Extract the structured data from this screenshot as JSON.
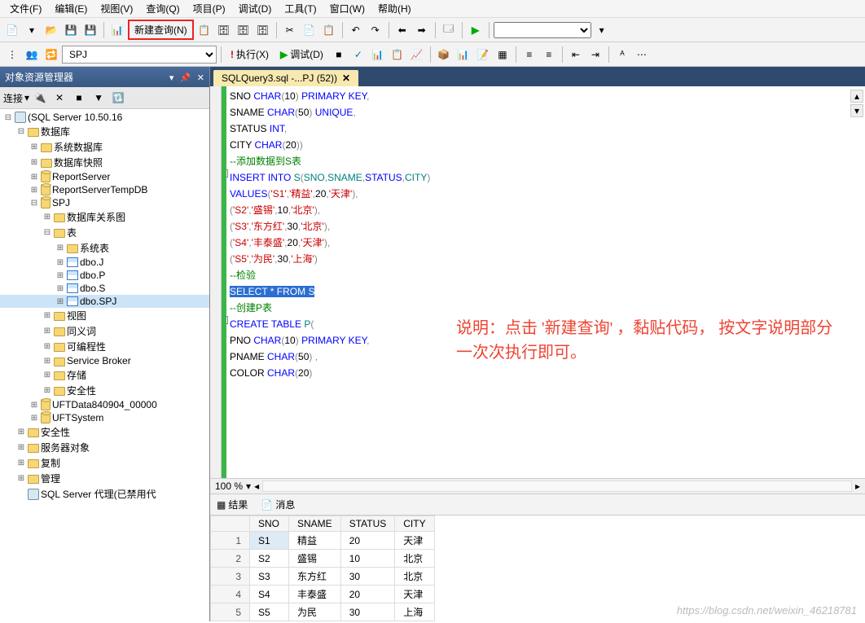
{
  "menu": [
    "文件(F)",
    "编辑(E)",
    "视图(V)",
    "查询(Q)",
    "项目(P)",
    "调试(D)",
    "工具(T)",
    "窗口(W)",
    "帮助(H)"
  ],
  "toolbar": {
    "new_query": "新建查询(N)",
    "execute": "执行(X)",
    "debug": "调试(D)",
    "db": "SPJ"
  },
  "sidebar": {
    "title": "对象资源管理器",
    "connect": "连接",
    "nodes": [
      {
        "ind": 0,
        "exp": "⊟",
        "ico": "server",
        "label": "(SQL Server 10.50.16"
      },
      {
        "ind": 1,
        "exp": "⊟",
        "ico": "folder",
        "label": "数据库"
      },
      {
        "ind": 2,
        "exp": "⊞",
        "ico": "folder",
        "label": "系统数据库"
      },
      {
        "ind": 2,
        "exp": "⊞",
        "ico": "folder",
        "label": "数据库快照"
      },
      {
        "ind": 2,
        "exp": "⊞",
        "ico": "db",
        "label": "ReportServer"
      },
      {
        "ind": 2,
        "exp": "⊞",
        "ico": "db",
        "label": "ReportServerTempDB"
      },
      {
        "ind": 2,
        "exp": "⊟",
        "ico": "db",
        "label": "SPJ"
      },
      {
        "ind": 3,
        "exp": "⊞",
        "ico": "folder",
        "label": "数据库关系图"
      },
      {
        "ind": 3,
        "exp": "⊟",
        "ico": "folder",
        "label": "表"
      },
      {
        "ind": 4,
        "exp": "⊞",
        "ico": "folder",
        "label": "系统表"
      },
      {
        "ind": 4,
        "exp": "⊞",
        "ico": "table",
        "label": "dbo.J"
      },
      {
        "ind": 4,
        "exp": "⊞",
        "ico": "table",
        "label": "dbo.P"
      },
      {
        "ind": 4,
        "exp": "⊞",
        "ico": "table",
        "label": "dbo.S"
      },
      {
        "ind": 4,
        "exp": "⊞",
        "ico": "table",
        "label": "dbo.SPJ",
        "sel": true
      },
      {
        "ind": 3,
        "exp": "⊞",
        "ico": "folder",
        "label": "视图"
      },
      {
        "ind": 3,
        "exp": "⊞",
        "ico": "folder",
        "label": "同义词"
      },
      {
        "ind": 3,
        "exp": "⊞",
        "ico": "folder",
        "label": "可编程性"
      },
      {
        "ind": 3,
        "exp": "⊞",
        "ico": "folder",
        "label": "Service Broker"
      },
      {
        "ind": 3,
        "exp": "⊞",
        "ico": "folder",
        "label": "存储"
      },
      {
        "ind": 3,
        "exp": "⊞",
        "ico": "folder",
        "label": "安全性"
      },
      {
        "ind": 2,
        "exp": "⊞",
        "ico": "db",
        "label": "UFTData840904_00000"
      },
      {
        "ind": 2,
        "exp": "⊞",
        "ico": "db",
        "label": "UFTSystem"
      },
      {
        "ind": 1,
        "exp": "⊞",
        "ico": "folder",
        "label": "安全性"
      },
      {
        "ind": 1,
        "exp": "⊞",
        "ico": "folder",
        "label": "服务器对象"
      },
      {
        "ind": 1,
        "exp": "⊞",
        "ico": "folder",
        "label": "复制"
      },
      {
        "ind": 1,
        "exp": "⊞",
        "ico": "folder",
        "label": "管理"
      },
      {
        "ind": 1,
        "exp": "",
        "ico": "server",
        "label": "SQL Server 代理(已禁用代"
      }
    ]
  },
  "tab": {
    "label": "SQLQuery3.sql -...PJ              (52))"
  },
  "editor_lines": [
    [
      {
        "t": "SNO ",
        "c": "black"
      },
      {
        "t": "CHAR",
        "c": "blue"
      },
      {
        "t": "(",
        "c": "gray"
      },
      {
        "t": "10",
        "c": "black"
      },
      {
        "t": ") ",
        "c": "gray"
      },
      {
        "t": "PRIMARY KEY",
        "c": "blue"
      },
      {
        "t": ",",
        "c": "gray"
      }
    ],
    [
      {
        "t": "SNAME ",
        "c": "black"
      },
      {
        "t": "CHAR",
        "c": "blue"
      },
      {
        "t": "(",
        "c": "gray"
      },
      {
        "t": "50",
        "c": "black"
      },
      {
        "t": ") ",
        "c": "gray"
      },
      {
        "t": "UNIQUE",
        "c": "blue"
      },
      {
        "t": ",",
        "c": "gray"
      }
    ],
    [
      {
        "t": "STATUS ",
        "c": "black"
      },
      {
        "t": "INT",
        "c": "blue"
      },
      {
        "t": ",",
        "c": "gray"
      }
    ],
    [
      {
        "t": "CITY ",
        "c": "black"
      },
      {
        "t": "CHAR",
        "c": "blue"
      },
      {
        "t": "(",
        "c": "gray"
      },
      {
        "t": "20",
        "c": "black"
      },
      {
        "t": "))",
        "c": "gray"
      }
    ],
    [
      {
        "t": "--添加数据到S表",
        "c": "comment"
      }
    ],
    [
      {
        "t": "INSERT INTO ",
        "c": "blue"
      },
      {
        "t": "S",
        "c": "green"
      },
      {
        "t": "(",
        "c": "gray"
      },
      {
        "t": "SNO",
        "c": "green"
      },
      {
        "t": ",",
        "c": "gray"
      },
      {
        "t": "SNAME",
        "c": "green"
      },
      {
        "t": ",",
        "c": "gray"
      },
      {
        "t": "STATUS",
        "c": "blue"
      },
      {
        "t": ",",
        "c": "gray"
      },
      {
        "t": "CITY",
        "c": "green"
      },
      {
        "t": ")",
        "c": "gray"
      }
    ],
    [
      {
        "t": "VALUES",
        "c": "blue"
      },
      {
        "t": "(",
        "c": "gray"
      },
      {
        "t": "'S1'",
        "c": "red"
      },
      {
        "t": ",",
        "c": "gray"
      },
      {
        "t": "'精益'",
        "c": "red"
      },
      {
        "t": ",",
        "c": "gray"
      },
      {
        "t": "20",
        "c": "black"
      },
      {
        "t": ",",
        "c": "gray"
      },
      {
        "t": "'天津'",
        "c": "red"
      },
      {
        "t": "),",
        "c": "gray"
      }
    ],
    [
      {
        "t": "(",
        "c": "gray"
      },
      {
        "t": "'S2'",
        "c": "red"
      },
      {
        "t": ",",
        "c": "gray"
      },
      {
        "t": "'盛锡'",
        "c": "red"
      },
      {
        "t": ",",
        "c": "gray"
      },
      {
        "t": "10",
        "c": "black"
      },
      {
        "t": ",",
        "c": "gray"
      },
      {
        "t": "'北京'",
        "c": "red"
      },
      {
        "t": "),",
        "c": "gray"
      }
    ],
    [
      {
        "t": "(",
        "c": "gray"
      },
      {
        "t": "'S3'",
        "c": "red"
      },
      {
        "t": ",",
        "c": "gray"
      },
      {
        "t": "'东方红'",
        "c": "red"
      },
      {
        "t": ",",
        "c": "gray"
      },
      {
        "t": "30",
        "c": "black"
      },
      {
        "t": ",",
        "c": "gray"
      },
      {
        "t": "'北京'",
        "c": "red"
      },
      {
        "t": "),",
        "c": "gray"
      }
    ],
    [
      {
        "t": "(",
        "c": "gray"
      },
      {
        "t": "'S4'",
        "c": "red"
      },
      {
        "t": ",",
        "c": "gray"
      },
      {
        "t": "'丰泰盛'",
        "c": "red"
      },
      {
        "t": ",",
        "c": "gray"
      },
      {
        "t": "20",
        "c": "black"
      },
      {
        "t": ",",
        "c": "gray"
      },
      {
        "t": "'天津'",
        "c": "red"
      },
      {
        "t": "),",
        "c": "gray"
      }
    ],
    [
      {
        "t": "(",
        "c": "gray"
      },
      {
        "t": "'S5'",
        "c": "red"
      },
      {
        "t": ",",
        "c": "gray"
      },
      {
        "t": "'为民'",
        "c": "red"
      },
      {
        "t": ",",
        "c": "gray"
      },
      {
        "t": "30",
        "c": "black"
      },
      {
        "t": ",",
        "c": "gray"
      },
      {
        "t": "'上海'",
        "c": "red"
      },
      {
        "t": ")",
        "c": "gray"
      }
    ],
    [
      {
        "t": "--检验",
        "c": "comment"
      }
    ],
    [
      {
        "t": "SELECT * FROM S",
        "c": "sel"
      }
    ],
    [
      {
        "t": "--创建P表",
        "c": "comment"
      }
    ],
    [
      {
        "t": "CREATE TABLE ",
        "c": "blue"
      },
      {
        "t": "P",
        "c": "green"
      },
      {
        "t": "(",
        "c": "gray"
      }
    ],
    [
      {
        "t": "PNO ",
        "c": "black"
      },
      {
        "t": "CHAR",
        "c": "blue"
      },
      {
        "t": "(",
        "c": "gray"
      },
      {
        "t": "10",
        "c": "black"
      },
      {
        "t": ") ",
        "c": "gray"
      },
      {
        "t": "PRIMARY KEY",
        "c": "blue"
      },
      {
        "t": ",",
        "c": "gray"
      }
    ],
    [
      {
        "t": "PNAME ",
        "c": "black"
      },
      {
        "t": "CHAR",
        "c": "blue"
      },
      {
        "t": "(",
        "c": "gray"
      },
      {
        "t": "50",
        "c": "black"
      },
      {
        "t": ") ,",
        "c": "gray"
      }
    ],
    [
      {
        "t": "COLOR ",
        "c": "black"
      },
      {
        "t": "CHAR",
        "c": "blue"
      },
      {
        "t": "(",
        "c": "gray"
      },
      {
        "t": "20",
        "c": "black"
      },
      {
        "t": ")",
        "c": "gray"
      }
    ]
  ],
  "zoom": "100 %",
  "results": {
    "tabs": {
      "result": "结果",
      "messages": "消息"
    },
    "headers": [
      "",
      "SNO",
      "SNAME",
      "STATUS",
      "CITY"
    ],
    "rows": [
      [
        "1",
        "S1",
        "精益",
        "20",
        "天津"
      ],
      [
        "2",
        "S2",
        "盛锡",
        "10",
        "北京"
      ],
      [
        "3",
        "S3",
        "东方红",
        "30",
        "北京"
      ],
      [
        "4",
        "S4",
        "丰泰盛",
        "20",
        "天津"
      ],
      [
        "5",
        "S5",
        "为民",
        "30",
        "上海"
      ]
    ]
  },
  "annotation": "说明：点击 '新建查询' ，黏贴代码，\n按文字说明部分一次次执行即可。",
  "watermark": "https://blog.csdn.net/weixin_46218781"
}
